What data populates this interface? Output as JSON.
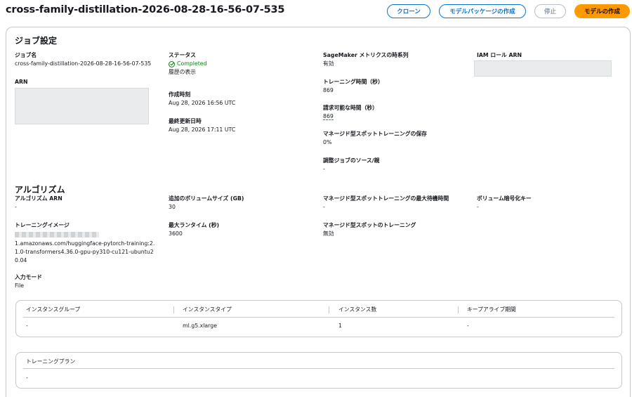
{
  "header": {
    "title": "cross-family-distillation-2026-08-28-16-56-07-535",
    "clone_label": "クローン",
    "create_package_label": "モデルパッケージの作成",
    "stop_label": "停止",
    "create_model_label": "モデルの作成"
  },
  "job_settings": {
    "title": "ジョブ設定",
    "job_name_label": "ジョブ名",
    "job_name": "cross-family-distillation-2026-08-28-16-56-07-535",
    "arn_label": "ARN",
    "status_label": "ステータス",
    "status_value": "Completed",
    "history_link": "履歴の表示",
    "created_label": "作成時刻",
    "created_value": "Aug 28, 2026 16:56 UTC",
    "updated_label": "最終更新日時",
    "updated_value": "Aug 28, 2026 17:11 UTC",
    "metrics_label": "SageMaker メトリクスの時系列",
    "metrics_value": "有効",
    "training_time_label": "トレーニング時間（秒）",
    "training_time_value": "869",
    "billable_label": "請求可能な時間（秒）",
    "billable_value": "869",
    "spot_savings_label": "マネージド型スポットトレーニングの保存",
    "spot_savings_value": "0%",
    "tuning_source_label": "調整ジョブのソース/親",
    "tuning_source_value": "-",
    "iam_label": "IAM ロール ARN"
  },
  "algorithm": {
    "title": "アルゴリズム",
    "arn_label": "アルゴリズム ARN",
    "arn_value": "-",
    "image_label": "トレーニングイメージ",
    "image_value": "1.amazonaws.com/huggingface-pytorch-training:2.1.0-transformers4.36.0-gpu-py310-cu121-ubuntu20.04",
    "input_mode_label": "入力モード",
    "input_mode_value": "File",
    "volume_size_label": "追加のボリュームサイズ (GB)",
    "volume_size_value": "30",
    "max_runtime_label": "最大ランタイム (秒)",
    "max_runtime_value": "3600",
    "spot_wait_label": "マネージド型スポットトレーニングの最大待機時間",
    "spot_wait_value": "-",
    "spot_training_label": "マネージド型スポットのトレーニング",
    "spot_training_value": "無効",
    "volume_key_label": "ボリューム暗号化キー",
    "volume_key_value": "-"
  },
  "instance_table": {
    "headers": [
      "インスタンスグループ",
      "インスタンスタイプ",
      "インスタンス数",
      "キープアライブ期間"
    ],
    "rows": [
      [
        "-",
        "ml.g5.xlarge",
        "1",
        "-"
      ]
    ]
  },
  "training_plan": {
    "header": "トレーニングプラン",
    "value": "-"
  },
  "colors": {
    "accent": "#0972d3",
    "primary": "#ff9900",
    "success": "#037f0c",
    "border": "#c6c6cd"
  }
}
